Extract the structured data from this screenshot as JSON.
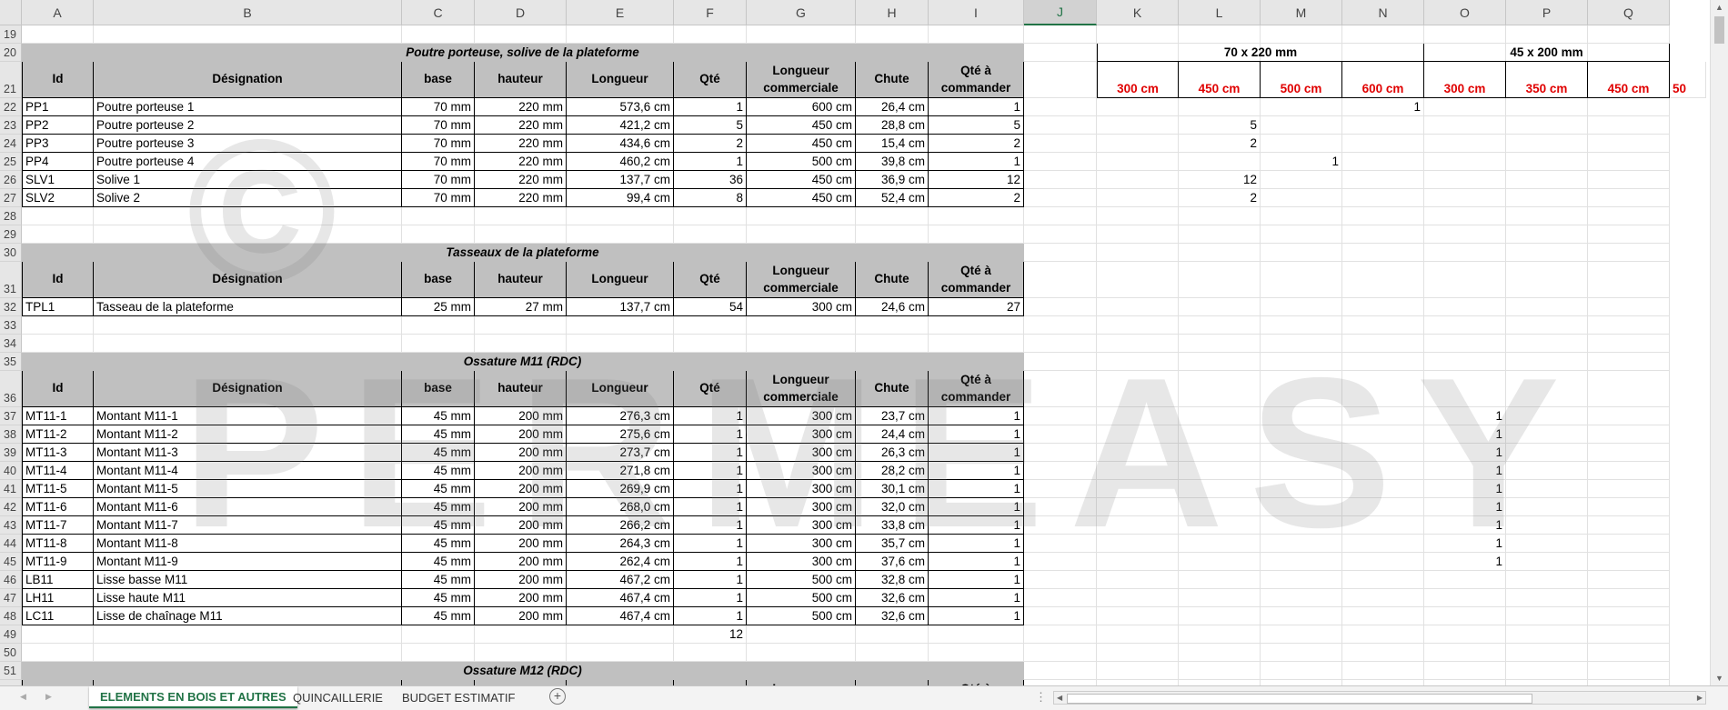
{
  "columns": [
    "A",
    "B",
    "C",
    "D",
    "E",
    "F",
    "G",
    "H",
    "I",
    "J",
    "K",
    "L",
    "M",
    "N",
    "O",
    "P",
    "Q"
  ],
  "selected_column": "J",
  "watermark": {
    "copyright": "©",
    "brand": "PERMEASY"
  },
  "side": {
    "group1": "70 x 220 mm",
    "group2": "45 x 200 mm",
    "lengths": [
      "300 cm",
      "450 cm",
      "500 cm",
      "600 cm",
      "300 cm",
      "350 cm",
      "450 cm",
      "50"
    ]
  },
  "header_labels": {
    "id": "Id",
    "designation": "Désignation",
    "base": "base",
    "hauteur": "hauteur",
    "longueur": "Longueur",
    "qte": "Qté",
    "longueur_comm": "Longueur commerciale",
    "chute": "Chute",
    "qte_cmd": "Qté à commander",
    "longueur_comm_partial": "Longueur",
    "qte_cmd_partial": "Qté à"
  },
  "section_titles": {
    "s1": "Poutre porteuse, solive de la plateforme",
    "s2": "Tasseaux de la plateforme",
    "s3": "Ossature M11 (RDC)",
    "s4": "Ossature M12 (RDC)"
  },
  "rows": [
    {
      "n": "19",
      "type": "empty"
    },
    {
      "n": "20",
      "type": "title",
      "title_key": "s1"
    },
    {
      "n": "21",
      "type": "header"
    },
    {
      "n": "22",
      "type": "data",
      "cells": [
        "PP1",
        "Poutre porteuse 1",
        "70 mm",
        "220 mm",
        "573,6 cm",
        "1",
        "600 cm",
        "26,4 cm",
        "1"
      ],
      "side": {
        "N": "1"
      }
    },
    {
      "n": "23",
      "type": "data",
      "cells": [
        "PP2",
        "Poutre porteuse 2",
        "70 mm",
        "220 mm",
        "421,2 cm",
        "5",
        "450 cm",
        "28,8 cm",
        "5"
      ],
      "side": {
        "L": "5"
      }
    },
    {
      "n": "24",
      "type": "data",
      "cells": [
        "PP3",
        "Poutre porteuse 3",
        "70 mm",
        "220 mm",
        "434,6 cm",
        "2",
        "450 cm",
        "15,4 cm",
        "2"
      ],
      "side": {
        "L": "2"
      }
    },
    {
      "n": "25",
      "type": "data",
      "cells": [
        "PP4",
        "Poutre porteuse 4",
        "70 mm",
        "220 mm",
        "460,2 cm",
        "1",
        "500 cm",
        "39,8 cm",
        "1"
      ],
      "side": {
        "M": "1"
      }
    },
    {
      "n": "26",
      "type": "data",
      "cells": [
        "SLV1",
        "Solive 1",
        "70 mm",
        "220 mm",
        "137,7 cm",
        "36",
        "450 cm",
        "36,9 cm",
        "12"
      ],
      "side": {
        "L": "12"
      }
    },
    {
      "n": "27",
      "type": "data",
      "cells": [
        "SLV2",
        "Solive 2",
        "70 mm",
        "220 mm",
        "99,4 cm",
        "8",
        "450 cm",
        "52,4 cm",
        "2"
      ],
      "side": {
        "L": "2"
      }
    },
    {
      "n": "28",
      "type": "empty"
    },
    {
      "n": "29",
      "type": "empty"
    },
    {
      "n": "30",
      "type": "title",
      "title_key": "s2"
    },
    {
      "n": "31",
      "type": "header"
    },
    {
      "n": "32",
      "type": "data",
      "cells": [
        "TPL1",
        "Tasseau de la plateforme",
        "25 mm",
        "27 mm",
        "137,7 cm",
        "54",
        "300 cm",
        "24,6 cm",
        "27"
      ],
      "side": {}
    },
    {
      "n": "33",
      "type": "empty"
    },
    {
      "n": "34",
      "type": "empty"
    },
    {
      "n": "35",
      "type": "title",
      "title_key": "s3"
    },
    {
      "n": "36",
      "type": "header"
    },
    {
      "n": "37",
      "type": "data",
      "cells": [
        "MT11-1",
        "Montant M11-1",
        "45 mm",
        "200 mm",
        "276,3 cm",
        "1",
        "300 cm",
        "23,7 cm",
        "1"
      ],
      "side": {
        "O": "1"
      }
    },
    {
      "n": "38",
      "type": "data",
      "cells": [
        "MT11-2",
        "Montant M11-2",
        "45 mm",
        "200 mm",
        "275,6 cm",
        "1",
        "300 cm",
        "24,4 cm",
        "1"
      ],
      "side": {
        "O": "1"
      }
    },
    {
      "n": "39",
      "type": "data",
      "cells": [
        "MT11-3",
        "Montant M11-3",
        "45 mm",
        "200 mm",
        "273,7 cm",
        "1",
        "300 cm",
        "26,3 cm",
        "1"
      ],
      "side": {
        "O": "1"
      }
    },
    {
      "n": "40",
      "type": "data",
      "cells": [
        "MT11-4",
        "Montant M11-4",
        "45 mm",
        "200 mm",
        "271,8 cm",
        "1",
        "300 cm",
        "28,2 cm",
        "1"
      ],
      "side": {
        "O": "1"
      }
    },
    {
      "n": "41",
      "type": "data",
      "cells": [
        "MT11-5",
        "Montant M11-5",
        "45 mm",
        "200 mm",
        "269,9 cm",
        "1",
        "300 cm",
        "30,1 cm",
        "1"
      ],
      "side": {
        "O": "1"
      }
    },
    {
      "n": "42",
      "type": "data",
      "cells": [
        "MT11-6",
        "Montant M11-6",
        "45 mm",
        "200 mm",
        "268,0 cm",
        "1",
        "300 cm",
        "32,0 cm",
        "1"
      ],
      "side": {
        "O": "1"
      }
    },
    {
      "n": "43",
      "type": "data",
      "cells": [
        "MT11-7",
        "Montant M11-7",
        "45 mm",
        "200 mm",
        "266,2 cm",
        "1",
        "300 cm",
        "33,8 cm",
        "1"
      ],
      "side": {
        "O": "1"
      }
    },
    {
      "n": "44",
      "type": "data",
      "cells": [
        "MT11-8",
        "Montant M11-8",
        "45 mm",
        "200 mm",
        "264,3 cm",
        "1",
        "300 cm",
        "35,7 cm",
        "1"
      ],
      "side": {
        "O": "1"
      }
    },
    {
      "n": "45",
      "type": "data",
      "cells": [
        "MT11-9",
        "Montant M11-9",
        "45 mm",
        "200 mm",
        "262,4 cm",
        "1",
        "300 cm",
        "37,6 cm",
        "1"
      ],
      "side": {
        "O": "1"
      }
    },
    {
      "n": "46",
      "type": "data",
      "cells": [
        "LB11",
        "Lisse basse M11",
        "45 mm",
        "200 mm",
        "467,2 cm",
        "1",
        "500 cm",
        "32,8 cm",
        "1"
      ],
      "side": {}
    },
    {
      "n": "47",
      "type": "data",
      "cells": [
        "LH11",
        "Lisse haute M11",
        "45 mm",
        "200 mm",
        "467,4 cm",
        "1",
        "500 cm",
        "32,6 cm",
        "1"
      ],
      "side": {}
    },
    {
      "n": "48",
      "type": "data",
      "cells": [
        "LC11",
        "Lisse de chaînage M11",
        "45 mm",
        "200 mm",
        "467,4 cm",
        "1",
        "500 cm",
        "32,6 cm",
        "1"
      ],
      "side": {}
    },
    {
      "n": "49",
      "type": "total",
      "value": "12"
    },
    {
      "n": "50",
      "type": "empty"
    },
    {
      "n": "51",
      "type": "title",
      "title_key": "s4"
    },
    {
      "n": "52",
      "type": "partialheader"
    }
  ],
  "tabs": [
    "ELEMENTS EN BOIS ET AUTRES",
    "QUINCAILLERIE",
    "BUDGET ESTIMATIF"
  ],
  "active_tab": 0,
  "icons": {
    "prev": "◀",
    "next": "▶",
    "add": "+",
    "more": "⋮",
    "up": "▲",
    "down": "▼"
  }
}
